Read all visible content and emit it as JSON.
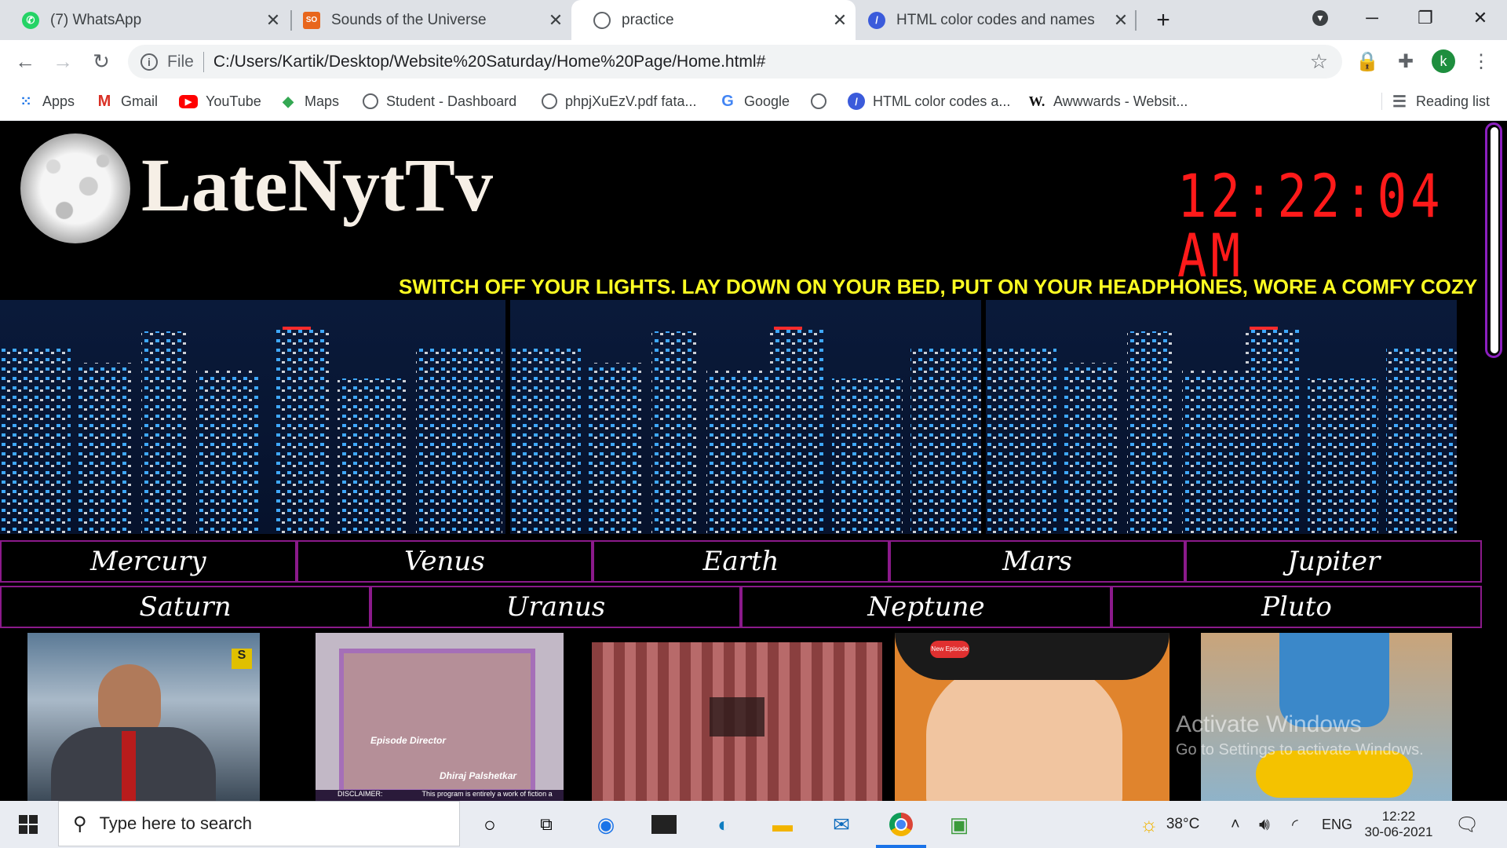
{
  "tabs": [
    {
      "title": "(7) WhatsApp",
      "icon": "whatsapp-icon",
      "color": "#25d366"
    },
    {
      "title": "Sounds of the Universe",
      "icon": "sotu-icon",
      "color": "#e8661c"
    },
    {
      "title": "practice",
      "icon": "globe-icon",
      "color": "#5f6368"
    },
    {
      "title": "HTML color codes and names",
      "icon": "html-color-icon",
      "color": "#3b5bdb"
    }
  ],
  "address": {
    "scheme_label": "File",
    "url": "C:/Users/Kartik/Desktop/Website%20Saturday/Home%20Page/Home.html#"
  },
  "profile_initial": "k",
  "bookmarks": [
    {
      "label": "Apps",
      "icon": "apps-grid-icon"
    },
    {
      "label": "Gmail",
      "icon": "gmail-icon"
    },
    {
      "label": "YouTube",
      "icon": "youtube-icon"
    },
    {
      "label": "Maps",
      "icon": "maps-icon"
    },
    {
      "label": "Student - Dashboard",
      "icon": "globe-icon"
    },
    {
      "label": "phpjXuEzV.pdf fata...",
      "icon": "globe-icon"
    },
    {
      "label": "Google",
      "icon": "google-icon"
    },
    {
      "label": "",
      "icon": "globe-icon"
    },
    {
      "label": "HTML color codes a...",
      "icon": "html-color-icon"
    },
    {
      "label": "Awwwards - Websit...",
      "icon": "awwwards-icon"
    }
  ],
  "reading_list": "Reading list",
  "site": {
    "title": "LateNytTv",
    "clock": "12:22:04 AM",
    "marquee": "SWITCH OFF YOUR LIGHTS. LAY DOWN ON YOUR BED, PUT ON YOUR HEADPHONES, WORE A COMFY COZY BLANKE"
  },
  "planets_row1": [
    "Mercury",
    "Venus",
    "Earth",
    "Mars",
    "Jupiter"
  ],
  "planets_row2": [
    "Saturn",
    "Uranus",
    "Neptune",
    "Pluto"
  ],
  "thumbnails": {
    "t2_line1": "Episode Director",
    "t2_line2": "Dhiraj Palshetkar",
    "t2_disclaimer": "DISCLAIMER:",
    "t2_disclaimer_text": "This program is entirely a work of fiction a",
    "t5_badge": "New Episode"
  },
  "activate": {
    "line1": "Activate Windows",
    "line2": "Go to Settings to activate Windows."
  },
  "taskbar": {
    "search_placeholder": "Type here to search",
    "weather": "38°C",
    "lang": "ENG",
    "time": "12:22",
    "date": "30-06-2021"
  }
}
